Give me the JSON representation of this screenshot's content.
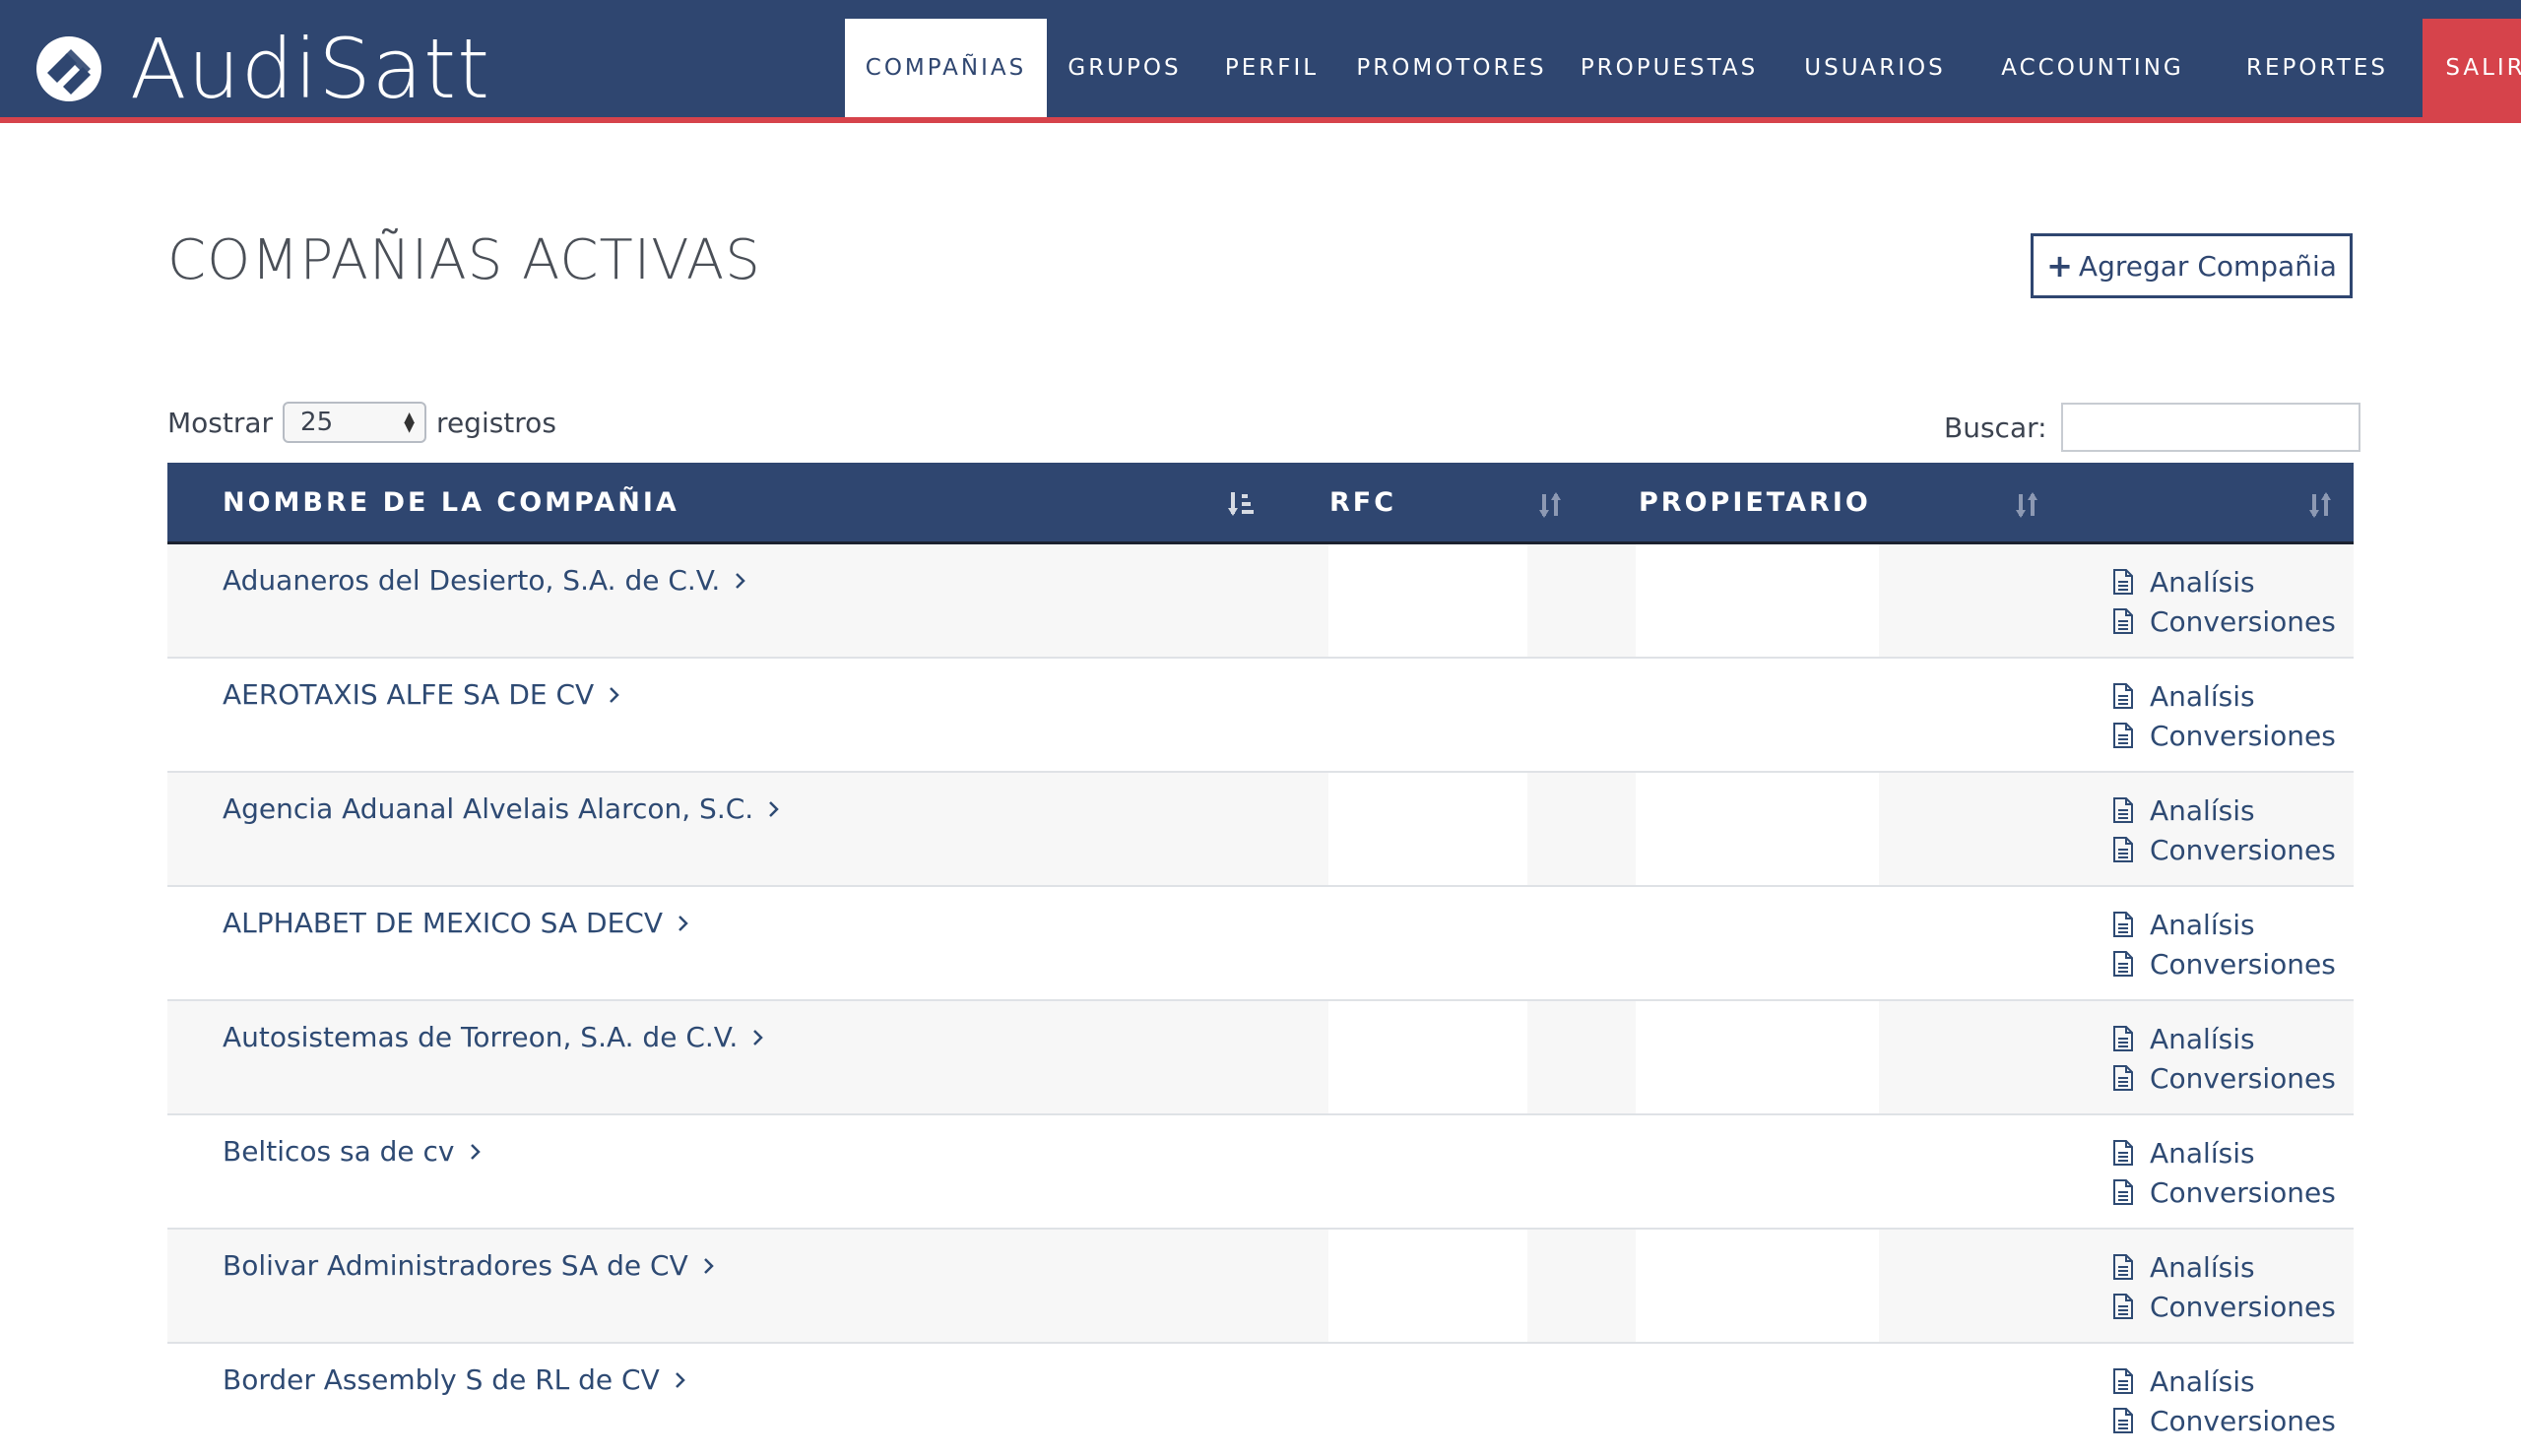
{
  "brand": {
    "name": "AudiSatt",
    "logo_icon": "audisatt-logo"
  },
  "colors": {
    "navy": "#2f4670",
    "red": "#d6434b",
    "text": "#2e4a73"
  },
  "nav": {
    "items": [
      {
        "label": "COMPAÑIAS",
        "active": true
      },
      {
        "label": "GRUPOS"
      },
      {
        "label": "PERFIL"
      },
      {
        "label": "PROMOTORES"
      },
      {
        "label": "PROPUESTAS"
      },
      {
        "label": "USUARIOS"
      },
      {
        "label": "ACCOUNTING"
      },
      {
        "label": "REPORTES"
      },
      {
        "label": "SALIR"
      }
    ]
  },
  "page": {
    "title": "COMPAÑIAS ACTIVAS",
    "add_button": "Agregar Compañia"
  },
  "controls": {
    "show_label": "Mostrar",
    "show_value": "25",
    "records_label": "registros",
    "search_label": "Buscar:",
    "search_value": ""
  },
  "table": {
    "headers": [
      "NOMBRE DE LA COMPAÑIA",
      "RFC",
      "PROPIETARIO"
    ],
    "action_labels": {
      "analysis": "Analísis",
      "conversions": "Conversiones"
    },
    "rows": [
      {
        "name": "Aduaneros del Desierto, S.A. de C.V."
      },
      {
        "name": "AEROTAXIS ALFE SA DE CV"
      },
      {
        "name": "Agencia Aduanal Alvelais Alarcon, S.C."
      },
      {
        "name": "ALPHABET DE MEXICO SA DECV"
      },
      {
        "name": "Autosistemas de Torreon, S.A. de C.V."
      },
      {
        "name": "Belticos sa de cv"
      },
      {
        "name": "Bolivar Administradores SA de CV"
      },
      {
        "name": "Border Assembly S de RL de CV"
      }
    ]
  }
}
